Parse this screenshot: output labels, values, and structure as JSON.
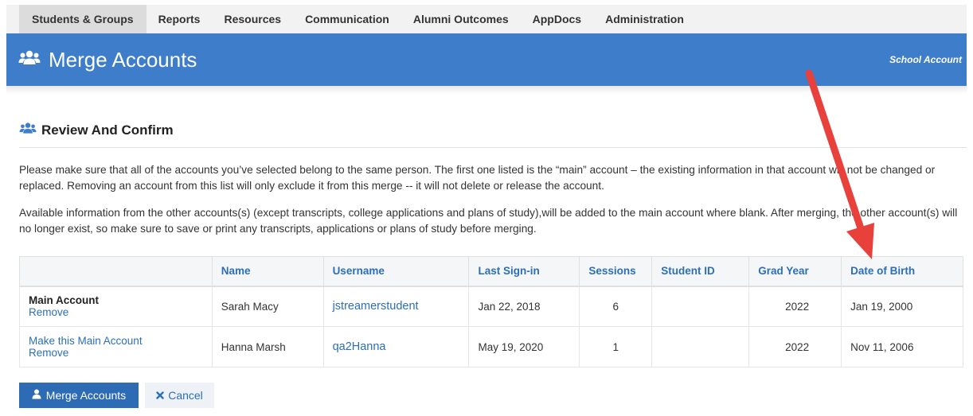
{
  "nav": {
    "items": [
      {
        "label": "Students & Groups",
        "active": true
      },
      {
        "label": "Reports",
        "active": false
      },
      {
        "label": "Resources",
        "active": false
      },
      {
        "label": "Communication",
        "active": false
      },
      {
        "label": "Alumni Outcomes",
        "active": false
      },
      {
        "label": "AppDocs",
        "active": false
      },
      {
        "label": "Administration",
        "active": false
      }
    ]
  },
  "header": {
    "title": "Merge Accounts",
    "account_type": "School Account",
    "icon": "users-icon",
    "bg_color": "#3d7dc9"
  },
  "section": {
    "title": "Review And Confirm",
    "icon": "users-icon",
    "paragraph1": "Please make sure that all of the accounts you’ve selected belong to the same person. The first one listed is the “main” account – the existing information in that account will not be changed or replaced. Removing an account from this list will only exclude it from this merge -- it will not delete or release the account.",
    "paragraph2": "Available information from the other accounts(s) (except transcripts, college applications and plans of study),will be added to the main account where blank. After merging, the other account(s) will no longer exist, so make sure to save or print any transcripts, applications or plans of study before merging."
  },
  "table": {
    "headers": [
      "",
      "Name",
      "Username",
      "Last Sign-in",
      "Sessions",
      "Student ID",
      "Grad Year",
      "Date of Birth"
    ],
    "rows": [
      {
        "status_label": "Main Account",
        "remove_label": "Remove",
        "name": "Sarah Macy",
        "username": "jstreamerstudent",
        "last_signin": "Jan 22, 2018",
        "sessions": "6",
        "student_id": "",
        "grad_year": "2022",
        "dob": "Jan 19, 2000"
      },
      {
        "status_label": "Make this Main Account",
        "remove_label": "Remove",
        "name": "Hanna Marsh",
        "username": "qa2Hanna",
        "last_signin": "May 19, 2020",
        "sessions": "1",
        "student_id": "",
        "grad_year": "2022",
        "dob": "Nov 11, 2006"
      }
    ]
  },
  "buttons": {
    "merge_label": "Merge Accounts",
    "merge_icon": "user-icon",
    "cancel_label": "Cancel",
    "cancel_icon": "close-icon"
  },
  "colors": {
    "accent": "#2d6bb5",
    "link": "#2c6fb8",
    "annotation_arrow": "#e8413c"
  }
}
